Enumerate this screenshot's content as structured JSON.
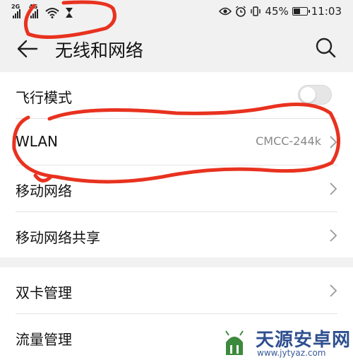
{
  "status_bar": {
    "sim1_network": "2G",
    "sim2_network": "4G",
    "battery": "45%",
    "time": "11:03"
  },
  "header": {
    "title": "无线和网络"
  },
  "settings": {
    "group1": [
      {
        "label": "飞行模式",
        "type": "toggle",
        "on": false
      },
      {
        "label": "WLAN",
        "value": "CMCC-244k",
        "type": "link"
      },
      {
        "label": "移动网络",
        "type": "link"
      },
      {
        "label": "移动网络共享",
        "type": "link"
      }
    ],
    "group2": [
      {
        "label": "双卡管理",
        "type": "link"
      },
      {
        "label": "流量管理",
        "type": "link"
      }
    ]
  },
  "colors": {
    "annotation_red": "#e8321f",
    "accent_text": "#888888",
    "background": "#f1f1f1"
  },
  "watermark": {
    "name": "天源安卓网",
    "url": "www.jytyaz.com"
  }
}
